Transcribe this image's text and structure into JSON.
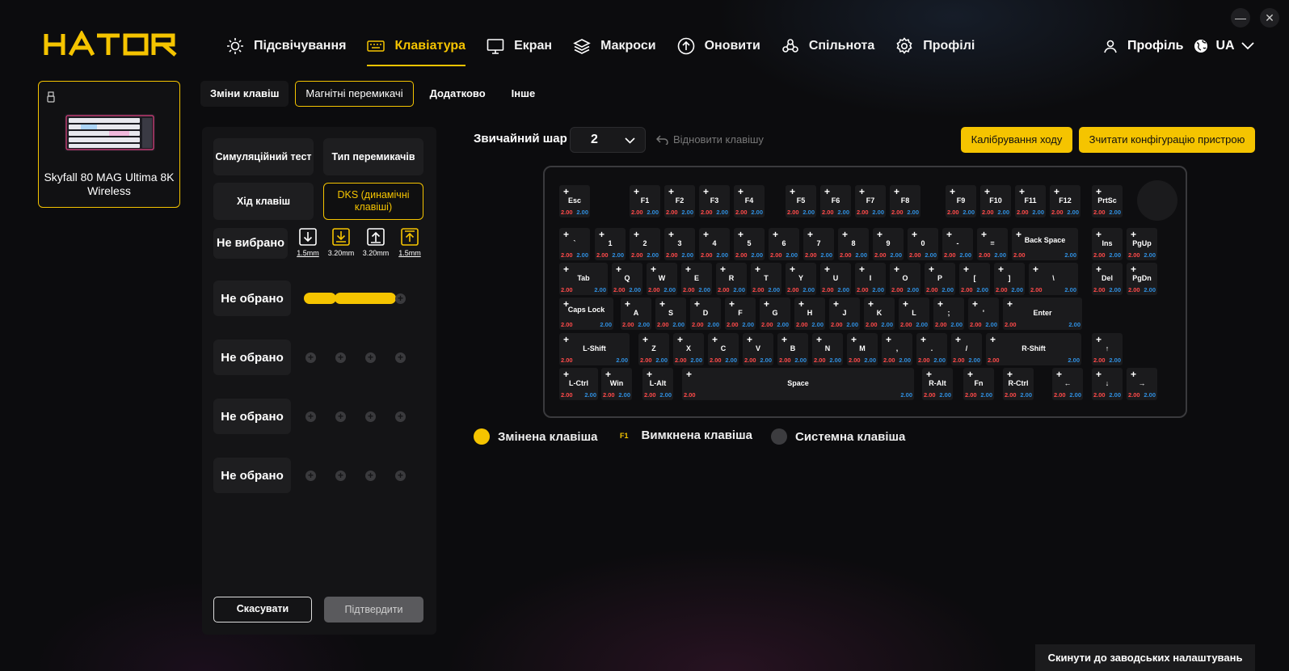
{
  "window": {
    "minimize_label": "—",
    "close_label": "✕"
  },
  "brand": {
    "logo_text": "HATOR",
    "accent": "#f5c400"
  },
  "nav": {
    "items": [
      {
        "label": "Підсвічування",
        "icon": "sun-icon"
      },
      {
        "label": "Клавіатура",
        "icon": "keyboard-icon",
        "active": true
      },
      {
        "label": "Екран",
        "icon": "monitor-icon"
      },
      {
        "label": "Макроси",
        "icon": "layers-icon"
      },
      {
        "label": "Оновити",
        "icon": "upload-icon"
      },
      {
        "label": "Спільнота",
        "icon": "community-icon"
      },
      {
        "label": "Профілі",
        "icon": "gear-icon"
      }
    ]
  },
  "top_right": {
    "profile_label": "Профіль",
    "language": "UA"
  },
  "device": {
    "name": "Skyfall 80 MAG Ultima 8K Wireless"
  },
  "subtabs": [
    {
      "label": "Зміни клавіш"
    },
    {
      "label": "Магнітні перемикачі",
      "active": true
    },
    {
      "label": "Додатково"
    },
    {
      "label": "Інше"
    }
  ],
  "left_panel": {
    "buttons": {
      "sim_test": "Симуляційний тест",
      "switch_type": "Тип перемикачів",
      "key_travel": "Хід клавіш",
      "dks": "DKS (динамічні клавіші)"
    },
    "header_status": "Не вибрано",
    "stages": [
      {
        "value": "1.5mm",
        "icon": "arrow-down-icon"
      },
      {
        "value": "3.20mm",
        "icon": "arrow-down-bottom-icon"
      },
      {
        "value": "3.20mm",
        "icon": "arrow-up-icon"
      },
      {
        "value": "1.5mm",
        "icon": "arrow-up-top-icon"
      }
    ],
    "slots": [
      "Не обрано",
      "Не обрано",
      "Не обрано",
      "Не обрано"
    ],
    "cancel_label": "Скасувати",
    "confirm_label": "Підтвердити"
  },
  "layer": {
    "label": "Звичайний шар",
    "value": "2",
    "restore_label": "Відновити клавішу"
  },
  "actions": {
    "calibrate": "Калібрування ходу",
    "read_config": "Зчитати конфігурацію пристрою"
  },
  "keyboard": {
    "press_value": "2.00",
    "release_value": "2.00",
    "rows": [
      [
        "Esc",
        "F1",
        "F2",
        "F3",
        "F4",
        "F5",
        "F6",
        "F7",
        "F8",
        "F9",
        "F10",
        "F11",
        "F12",
        "PrtSc"
      ],
      [
        "`",
        "1",
        "2",
        "3",
        "4",
        "5",
        "6",
        "7",
        "8",
        "9",
        "0",
        "-",
        "=",
        "Back Space",
        "Ins",
        "PgUp"
      ],
      [
        "Tab",
        "Q",
        "W",
        "E",
        "R",
        "T",
        "Y",
        "U",
        "I",
        "O",
        "P",
        "[",
        "]",
        "\\",
        "Del",
        "PgDn"
      ],
      [
        "Caps Lock",
        "A",
        "S",
        "D",
        "F",
        "G",
        "H",
        "J",
        "K",
        "L",
        ";",
        "'",
        "Enter"
      ],
      [
        "L-Shift",
        "Z",
        "X",
        "C",
        "V",
        "B",
        "N",
        "M",
        ",",
        ".",
        "/",
        "R-Shift",
        "↑"
      ],
      [
        "L-Ctrl",
        "Win",
        "L-Alt",
        "Space",
        "R-Alt",
        "Fn",
        "R-Ctrl",
        "←",
        "↓",
        "→"
      ]
    ]
  },
  "legend": {
    "changed": "Змінена клавіша",
    "disabled_marker": "F1",
    "disabled": "Вимкнена клавіша",
    "system": "Системна клавіша",
    "changed_color": "#f5c400",
    "system_color": "#3c3c3f"
  },
  "footer": {
    "reset_label": "Скинути до заводських налаштувань"
  }
}
